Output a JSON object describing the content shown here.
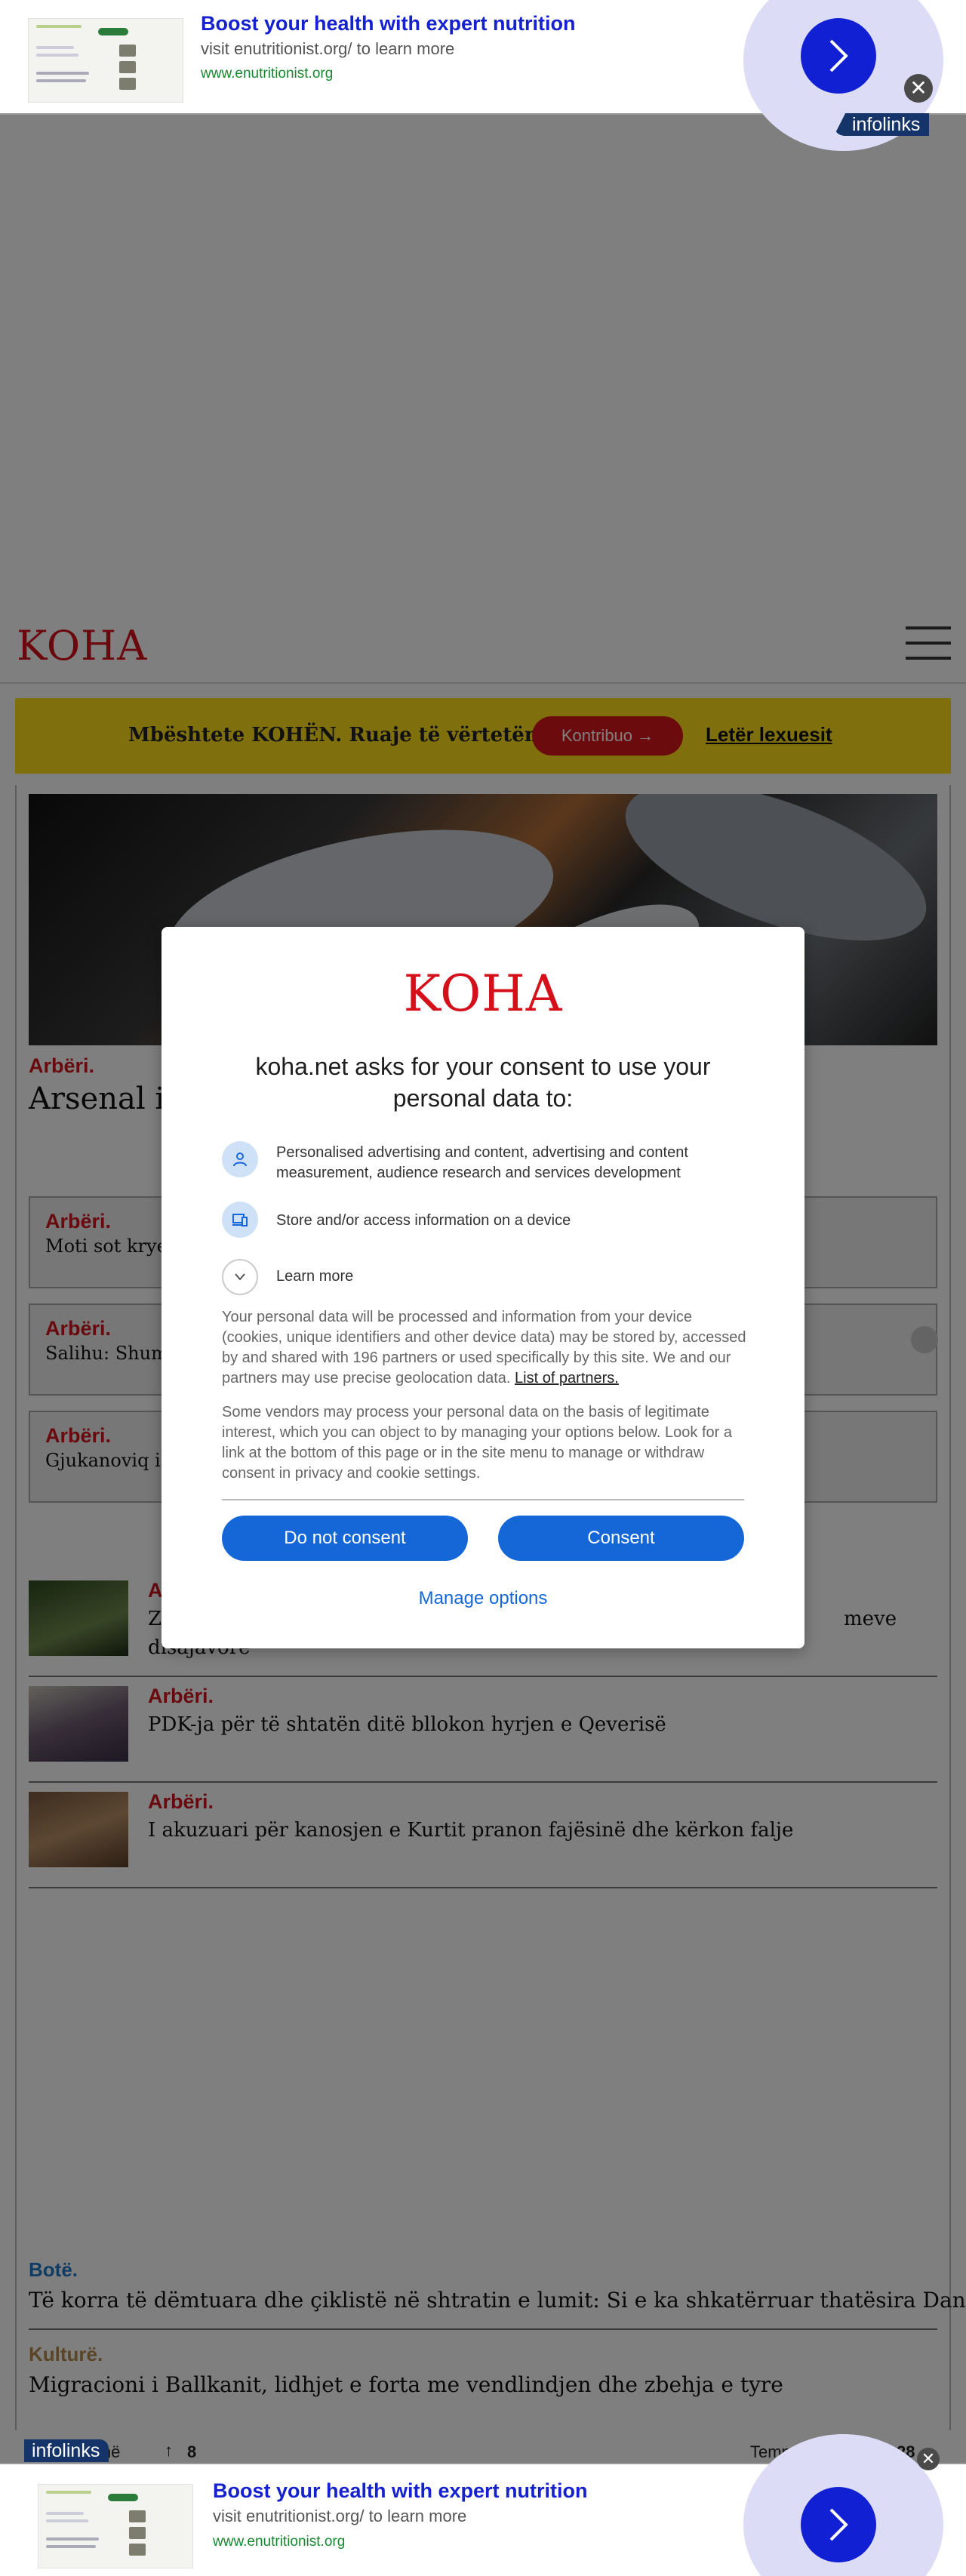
{
  "ad": {
    "title": "Boost your health with expert nutrition",
    "subtitle": "visit enutritionist.org/ to learn more",
    "url": "www.enutritionist.org",
    "badge": "infolinks",
    "close": "✕"
  },
  "site": {
    "logo": "KOHA",
    "support_text": "Mbështete KOHËN. Ruaje të vërtetën",
    "support_button": "Kontribuo →",
    "support_link": "Letër lexuesit"
  },
  "hero": {
    "category": "Arbëri.",
    "title": "Arsenal i"
  },
  "boxes": [
    {
      "category": "Arbëri.",
      "headline": "Moti sot kryes"
    },
    {
      "category": "Arbëri.",
      "headline": "Salihu: Shumi"
    },
    {
      "category": "Arbëri.",
      "headline": "Gjukanoviq i c"
    }
  ],
  "list_items": [
    {
      "category": "Arbëri.",
      "headline": "Z",
      "headline_end": "meve",
      "headline_line2": "disajavore"
    },
    {
      "category": "Arbëri.",
      "headline": "PDK-ja për të shtatën ditë bllokon hyrjen e Qeverisë"
    },
    {
      "category": "Arbëri.",
      "headline": "I akuzuari për kanosjen e Kurtit pranon fajësinë dhe kërkon falje"
    }
  ],
  "bottom_stories": [
    {
      "category": "Botë.",
      "headline": "Të korra të dëmtuara dhe çiklistë në shtratin e lumit: Si e ka shkatërruar thatësira Danubin"
    },
    {
      "category": "Kulturë.",
      "headline": "Migracioni i Ballkanit, lidhjet e forta me vendlindjen dhe zbehja e tyre"
    }
  ],
  "footer": {
    "left_text": "inë",
    "arrow": "↑",
    "count": "8",
    "temp_label": "Temperatura",
    "temp_value": "28"
  },
  "consent": {
    "logo": "KOHA",
    "heading": "koha.net asks for your consent to use your personal data to:",
    "purposes": [
      {
        "icon": "person-icon",
        "text": "Personalised advertising and content, advertising and content measurement, audience research and services development"
      },
      {
        "icon": "devices-icon",
        "text": "Store and/or access information on a device"
      }
    ],
    "learn_more": "Learn more",
    "paragraph1": "Your personal data will be processed and information from your device (cookies, unique identifiers and other device data) may be stored by, accessed by and shared with 196 partners or used specifically by this site. We and our partners may use precise geolocation data.",
    "partners_link": "List of partners.",
    "paragraph2": "Some vendors may process your personal data on the basis of legitimate interest, which you can object to by managing your options below. Look for a link at the bottom of this page or in the site menu to manage or withdraw consent in privacy and cookie settings.",
    "do_not_consent": "Do not consent",
    "consent": "Consent",
    "manage_options": "Manage options"
  },
  "colors": {
    "brand_red": "#d4111b",
    "support_yellow": "#fee11b",
    "consent_blue": "#1567d8",
    "ad_blue": "#1520ce",
    "ad_green": "#18882e"
  }
}
